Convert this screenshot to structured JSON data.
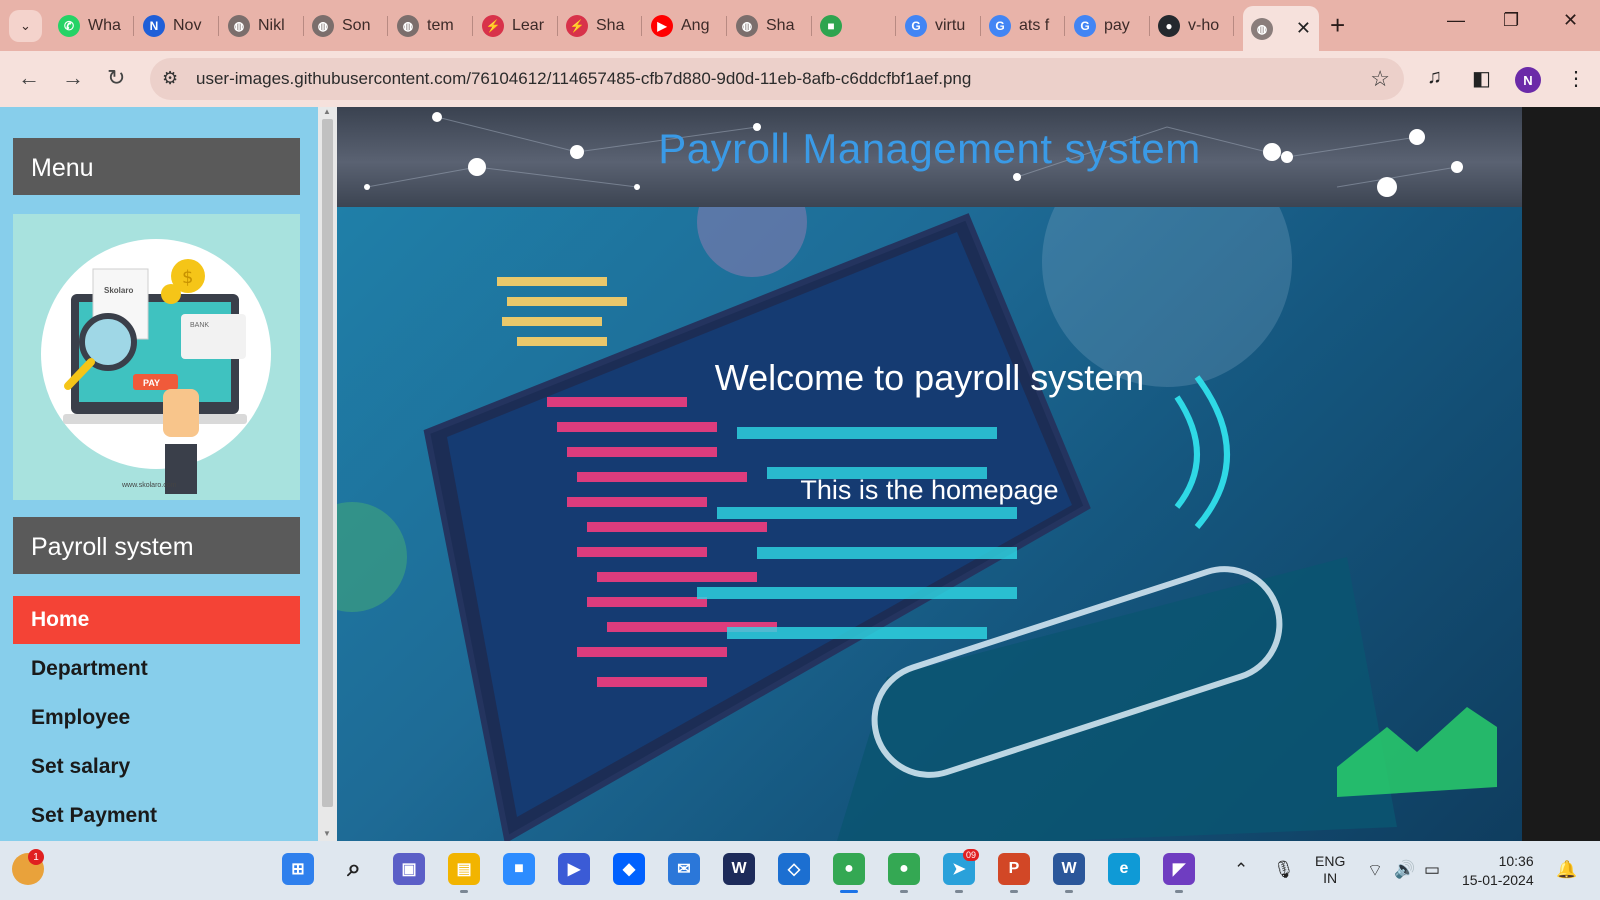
{
  "browser": {
    "tabs": [
      {
        "label": "Wha",
        "icon": "whatsapp-icon",
        "color": "#25d366",
        "glyph": "✆"
      },
      {
        "label": "Nov",
        "icon": "notion-icon",
        "color": "#1f5fd8",
        "glyph": "N"
      },
      {
        "label": "Nikl",
        "icon": "globe-icon",
        "color": "#7b6e6c",
        "glyph": "◍"
      },
      {
        "label": "Son",
        "icon": "globe-icon",
        "color": "#7b6e6c",
        "glyph": "◍"
      },
      {
        "label": "tem",
        "icon": "globe-icon",
        "color": "#7b6e6c",
        "glyph": "◍"
      },
      {
        "label": "Lear",
        "icon": "bolt-icon",
        "color": "#d8324a",
        "glyph": "⚡"
      },
      {
        "label": "Sha",
        "icon": "bolt-icon",
        "color": "#d8324a",
        "glyph": "⚡"
      },
      {
        "label": "Ang",
        "icon": "youtube-icon",
        "color": "#ff0000",
        "glyph": "▶"
      },
      {
        "label": "Sha",
        "icon": "globe-icon",
        "color": "#7b6e6c",
        "glyph": "◍"
      },
      {
        "label": "",
        "icon": "meet-icon",
        "color": "#2ea44f",
        "glyph": "■"
      },
      {
        "label": "virtu",
        "icon": "google-icon",
        "color": "#4285f4",
        "glyph": "G"
      },
      {
        "label": "ats f",
        "icon": "google-icon",
        "color": "#4285f4",
        "glyph": "G"
      },
      {
        "label": "pay",
        "icon": "google-icon",
        "color": "#4285f4",
        "glyph": "G"
      },
      {
        "label": "v-ho",
        "icon": "github-icon",
        "color": "#24292e",
        "glyph": "●"
      }
    ],
    "url": "user-images.githubusercontent.com/76104612/114657485-cfb7d880-9d0d-11eb-8afb-c6ddcfbf1aef.png",
    "profile_initial": "N"
  },
  "page": {
    "sidebar": {
      "menu_heading": "Menu",
      "section_heading": "Payroll system",
      "nav": [
        {
          "label": "Home",
          "active": true
        },
        {
          "label": "Department",
          "active": false
        },
        {
          "label": "Employee",
          "active": false
        },
        {
          "label": "Set salary",
          "active": false
        },
        {
          "label": "Set Payment",
          "active": false
        }
      ],
      "illustration": {
        "brand_text": "Skolaro",
        "pay_button": "PAY",
        "bank_label": "BANK",
        "footer_url": "www.skolaro.com"
      }
    },
    "title": "Payroll Management system",
    "welcome": "Welcome to payroll system",
    "subtitle": "This is the homepage",
    "colors": {
      "sidebar_bg": "#87ceeb",
      "header_bg": "#5a5a5a",
      "active_nav": "#f44336",
      "title_blue": "#3a9ae6"
    }
  },
  "taskbar": {
    "weather_badge": "1",
    "apps": [
      {
        "name": "start-icon",
        "color": "#2f80ed",
        "glyph": "⊞"
      },
      {
        "name": "search-icon",
        "color": "#dfe7ef",
        "glyph": "⌕"
      },
      {
        "name": "teams-icon",
        "color": "#5b5fc7",
        "glyph": "▣"
      },
      {
        "name": "file-explorer-icon",
        "color": "#f2b400",
        "glyph": "▤"
      },
      {
        "name": "zoom-icon",
        "color": "#2d8cff",
        "glyph": "■"
      },
      {
        "name": "power-automate-icon",
        "color": "#3b5bd6",
        "glyph": "▶"
      },
      {
        "name": "dropbox-icon",
        "color": "#0061fe",
        "glyph": "◆"
      },
      {
        "name": "mail-icon",
        "color": "#2b77d9",
        "glyph": "✉"
      },
      {
        "name": "webex-icon",
        "color": "#1d2b5a",
        "glyph": "W"
      },
      {
        "name": "copilot-icon",
        "color": "#1c6fd1",
        "glyph": "◇"
      },
      {
        "name": "chrome-icon",
        "color": "#34a853",
        "glyph": "●"
      },
      {
        "name": "chrome-profile-icon",
        "color": "#34a853",
        "glyph": "●"
      },
      {
        "name": "telegram-icon",
        "color": "#2aa1da",
        "glyph": "➤"
      },
      {
        "name": "powerpoint-icon",
        "color": "#d24726",
        "glyph": "P"
      },
      {
        "name": "word-icon",
        "color": "#2b579a",
        "glyph": "W"
      },
      {
        "name": "edge-icon",
        "color": "#0f9ad6",
        "glyph": "e"
      },
      {
        "name": "visual-studio-icon",
        "color": "#6f3dc1",
        "glyph": "◤"
      }
    ],
    "telegram_badge": "09",
    "language_top": "ENG",
    "language_bottom": "IN",
    "time": "10:36",
    "date": "15-01-2024"
  }
}
